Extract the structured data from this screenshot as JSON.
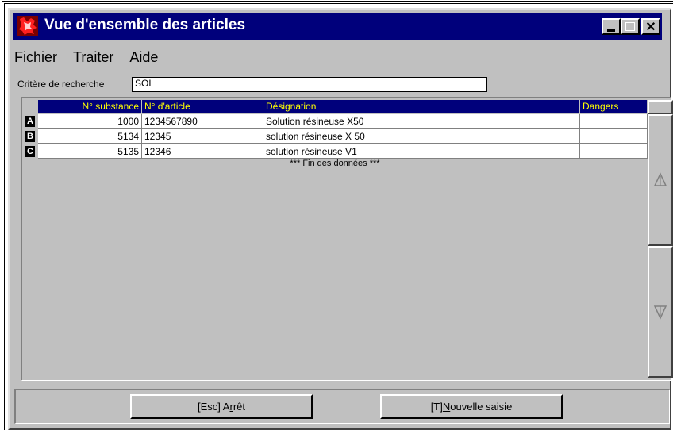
{
  "window": {
    "title": "Vue d'ensemble des articles",
    "minimize_label": "_",
    "maximize_label": "",
    "close_label": "✕"
  },
  "menu": [
    {
      "ul": "F",
      "rest": "ichier"
    },
    {
      "ul": "T",
      "rest": "raiter"
    },
    {
      "ul": "A",
      "rest": "ide"
    }
  ],
  "search": {
    "label": "Critère de recherche",
    "value": "SOL"
  },
  "table": {
    "columns": [
      "N° substance",
      "N° d'article",
      "Désignation",
      "Dangers"
    ],
    "rows": [
      {
        "marker": "A",
        "substance": "1000",
        "article": "1234567890",
        "designation": "Solution résineuse X50",
        "dangers": ""
      },
      {
        "marker": "B",
        "substance": "5134",
        "article": "12345",
        "designation": "solution résineuse X 50",
        "dangers": ""
      },
      {
        "marker": "C",
        "substance": "5135",
        "article": "12346",
        "designation": "solution résineuse V1",
        "dangers": ""
      }
    ],
    "end_text": "*** Fin des données ***"
  },
  "scroll": {
    "up_icon": "arrow-up-icon",
    "down_icon": "arrow-down-icon"
  },
  "buttons": {
    "stop": {
      "pre": "[Esc] A",
      "ul": "r",
      "post": "rêt"
    },
    "new": {
      "pre": "[T] ",
      "ul": "N",
      "post": "ouvelle saisie"
    }
  },
  "colors": {
    "titlebar": "#00007b",
    "header_bg": "#00007b",
    "header_text": "#ffff00",
    "window_bg": "#c0c0c0"
  }
}
